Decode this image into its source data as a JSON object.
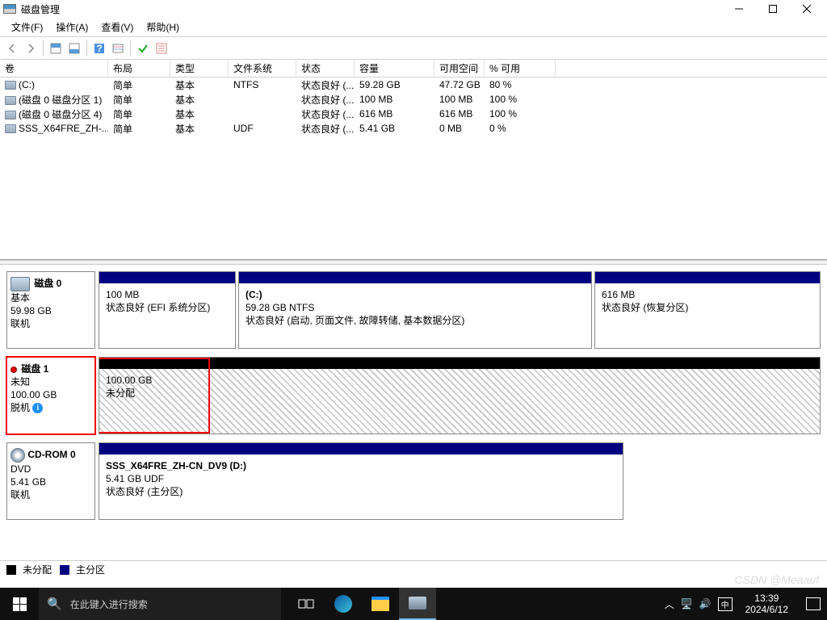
{
  "window": {
    "title": "磁盘管理"
  },
  "menu": {
    "file": "文件(F)",
    "action": "操作(A)",
    "view": "查看(V)",
    "help": "帮助(H)"
  },
  "columns": {
    "volume": "卷",
    "layout": "布局",
    "type": "类型",
    "fs": "文件系统",
    "status": "状态",
    "capacity": "容量",
    "free": "可用空间",
    "pct": "% 可用"
  },
  "volumes": [
    {
      "name": "(C:)",
      "layout": "简单",
      "type": "基本",
      "fs": "NTFS",
      "status": "状态良好 (...",
      "capacity": "59.28 GB",
      "free": "47.72 GB",
      "pct": "80 %"
    },
    {
      "name": "(磁盘 0 磁盘分区 1)",
      "layout": "简单",
      "type": "基本",
      "fs": "",
      "status": "状态良好 (...",
      "capacity": "100 MB",
      "free": "100 MB",
      "pct": "100 %"
    },
    {
      "name": "(磁盘 0 磁盘分区 4)",
      "layout": "简单",
      "type": "基本",
      "fs": "",
      "status": "状态良好 (...",
      "capacity": "616 MB",
      "free": "616 MB",
      "pct": "100 %"
    },
    {
      "name": "SSS_X64FRE_ZH-...",
      "layout": "简单",
      "type": "基本",
      "fs": "UDF",
      "status": "状态良好 (...",
      "capacity": "5.41 GB",
      "free": "0 MB",
      "pct": "0 %"
    }
  ],
  "disks": {
    "disk0": {
      "name": "磁盘 0",
      "type": "基本",
      "size": "59.98 GB",
      "status": "联机",
      "parts": [
        {
          "title": "",
          "sub": "100 MB",
          "status": "状态良好 (EFI 系统分区)"
        },
        {
          "title": "(C:)",
          "sub": "59.28 GB NTFS",
          "status": "状态良好 (启动, 页面文件, 故障转储, 基本数据分区)"
        },
        {
          "title": "",
          "sub": "616 MB",
          "status": "状态良好 (恢复分区)"
        }
      ]
    },
    "disk1": {
      "name": "磁盘 1",
      "type": "未知",
      "size": "100.00 GB",
      "status": "脱机",
      "parts": [
        {
          "sub": "100.00 GB",
          "status": "未分配"
        }
      ]
    },
    "cdrom0": {
      "name": "CD-ROM 0",
      "type": "DVD",
      "size": "5.41 GB",
      "status": "联机",
      "parts": [
        {
          "title": "SSS_X64FRE_ZH-CN_DV9  (D:)",
          "sub": "5.41 GB UDF",
          "status": "状态良好 (主分区)"
        }
      ]
    }
  },
  "legend": {
    "unalloc": "未分配",
    "primary": "主分区"
  },
  "taskbar": {
    "search_placeholder": "在此键入进行搜索",
    "ime": "中",
    "time": "13:39",
    "date": "2024/6/12"
  },
  "watermark": "CSDN @Meaauf"
}
